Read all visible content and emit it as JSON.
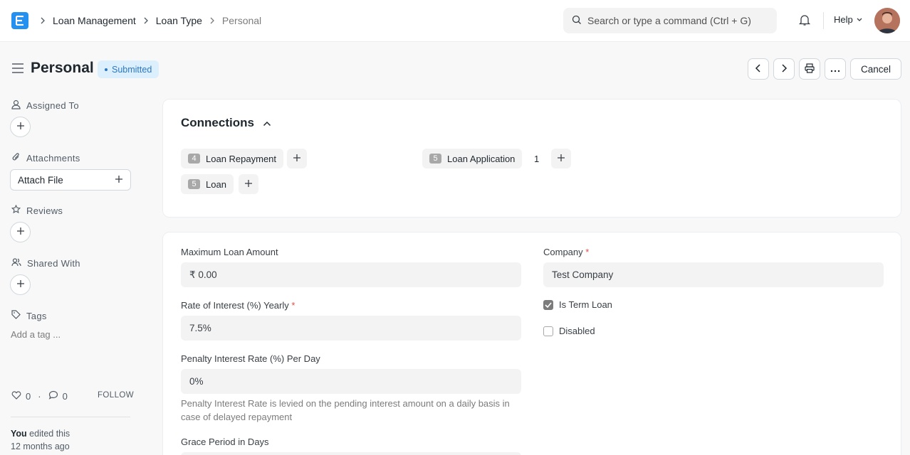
{
  "navbar": {
    "breadcrumbs": [
      "Loan Management",
      "Loan Type",
      "Personal"
    ],
    "search_placeholder": "Search or type a command (Ctrl + G)",
    "help_label": "Help"
  },
  "page": {
    "title": "Personal",
    "status": "Submitted",
    "cancel_label": "Cancel"
  },
  "sidebar": {
    "assigned_to": "Assigned To",
    "attachments": "Attachments",
    "attach_file": "Attach File",
    "reviews": "Reviews",
    "shared_with": "Shared With",
    "tags": "Tags",
    "add_tag": "Add a tag ...",
    "likes": "0",
    "comments": "0",
    "follow": "FOLLOW",
    "edited_by": "You",
    "edited_text": "edited this",
    "edited_when": "12 months ago"
  },
  "connections": {
    "title": "Connections",
    "items": [
      {
        "count": "4",
        "label": "Loan Repayment",
        "open": ""
      },
      {
        "count": "5",
        "label": "Loan Application",
        "open": "1"
      },
      {
        "count": "5",
        "label": "Loan",
        "open": ""
      }
    ]
  },
  "form": {
    "max_loan_label": "Maximum Loan Amount",
    "max_loan_value": "₹ 0.00",
    "rate_label": "Rate of Interest (%) Yearly",
    "rate_value": "7.5%",
    "penalty_label": "Penalty Interest Rate (%) Per Day",
    "penalty_value": "0%",
    "penalty_desc_1": "Penalty Interest Rate is levied on the pending interest amount on a daily basis in",
    "penalty_desc_2": "case of delayed repayment",
    "grace_label": "Grace Period in Days",
    "company_label": "Company",
    "company_value": "Test Company",
    "term_loan_label": "Is Term Loan",
    "term_loan_checked": true,
    "disabled_label": "Disabled",
    "disabled_checked": false,
    "required_mark": "*"
  },
  "colors": {
    "accent": "#2490ef",
    "badge_bg": "#dbeffd",
    "badge_text": "#2c77c2",
    "required": "#e24c4c"
  }
}
